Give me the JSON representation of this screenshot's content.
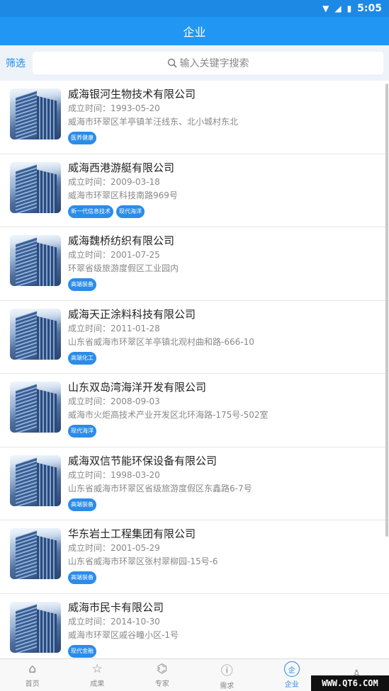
{
  "status_bar": {
    "time": "5:05"
  },
  "app_bar": {
    "title": "企业"
  },
  "search": {
    "filter_label": "筛选",
    "placeholder": "输入关键字搜索"
  },
  "companies": [
    {
      "name": "威海银河生物技术有限公司",
      "established": "成立时间：1993-05-20",
      "address": "威海市环翠区羊亭镇羊汪线东、北小城村东北",
      "tags": [
        "医养健康"
      ]
    },
    {
      "name": "威海西港游艇有限公司",
      "established": "成立时间：2009-03-18",
      "address": "威海市环翠区科技南路969号",
      "tags": [
        "新一代信息技术",
        "现代海洋"
      ]
    },
    {
      "name": "威海魏桥纺织有限公司",
      "established": "成立时间：2001-07-25",
      "address": "环翠省级旅游度假区工业园内",
      "tags": [
        "高端装备"
      ]
    },
    {
      "name": "威海天正涂料科技有限公司",
      "established": "成立时间：2011-01-28",
      "address": "山东省威海市环翠区羊亭镇北观村曲和路-666-10",
      "tags": [
        "高端化工"
      ]
    },
    {
      "name": "山东双岛湾海洋开发有限公司",
      "established": "成立时间：2008-09-03",
      "address": "威海市火炬高技术产业开发区北环海路-175号-502室",
      "tags": [
        "现代海洋"
      ]
    },
    {
      "name": "威海双信节能环保设备有限公司",
      "established": "成立时间：1998-03-20",
      "address": "山东省威海市环翠区省级旅游度假区东鑫路6-7号",
      "tags": [
        "高端装备"
      ]
    },
    {
      "name": "华东岩土工程集团有限公司",
      "established": "成立时间：2001-05-29",
      "address": "山东省威海市环翠区张村翠柳园-15号-6",
      "tags": [
        "高端装备"
      ]
    },
    {
      "name": "威海市民卡有限公司",
      "established": "成立时间：2014-10-30",
      "address": "威海市环翠区戚谷疃小区-1号",
      "tags": [
        "现代金融"
      ]
    }
  ],
  "bottom_nav": [
    {
      "label": "首页",
      "icon": "home-icon"
    },
    {
      "label": "成果",
      "icon": "star-icon"
    },
    {
      "label": "专家",
      "icon": "graduation-cap-icon"
    },
    {
      "label": "需求",
      "icon": "info-icon"
    },
    {
      "label": "企业",
      "icon": "enterprise-icon",
      "active": true
    },
    {
      "label": "",
      "icon": "profile-icon"
    }
  ],
  "watermark": "WWW.QT6.COM"
}
